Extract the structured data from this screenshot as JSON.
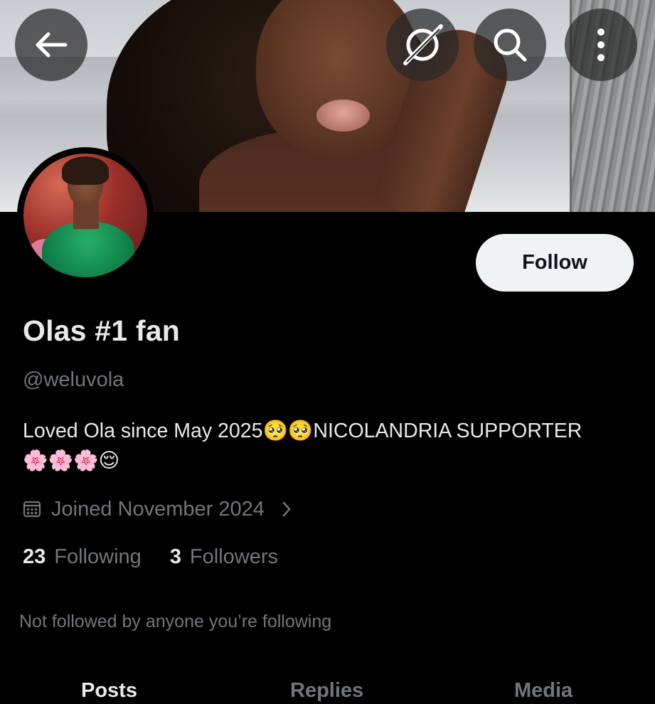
{
  "header": {
    "back_icon": "arrow-left-icon",
    "grok_icon": "grok-icon",
    "search_icon": "search-icon",
    "more_icon": "more-vertical-icon"
  },
  "profile": {
    "display_name": "Olas #1 fan",
    "handle": "@weluvola",
    "bio_line1": "Loved Ola since May 2025🥺🥺NICOLANDRIA SUPPORTER",
    "bio_line2": "🌸🌸🌸😌",
    "joined": "Joined November 2024",
    "follow_label": "Follow"
  },
  "stats": {
    "following_count": "23",
    "following_label": "Following",
    "followers_count": "3",
    "followers_label": "Followers"
  },
  "social_context": "Not followed by anyone you’re following",
  "tabs": [
    {
      "label": "Posts",
      "active": true
    },
    {
      "label": "Replies",
      "active": false
    },
    {
      "label": "Media",
      "active": false
    }
  ],
  "colors": {
    "background": "#000000",
    "primary_text": "#e7e9ea",
    "secondary_text": "#71767b",
    "follow_button_bg": "#eff3f4"
  }
}
